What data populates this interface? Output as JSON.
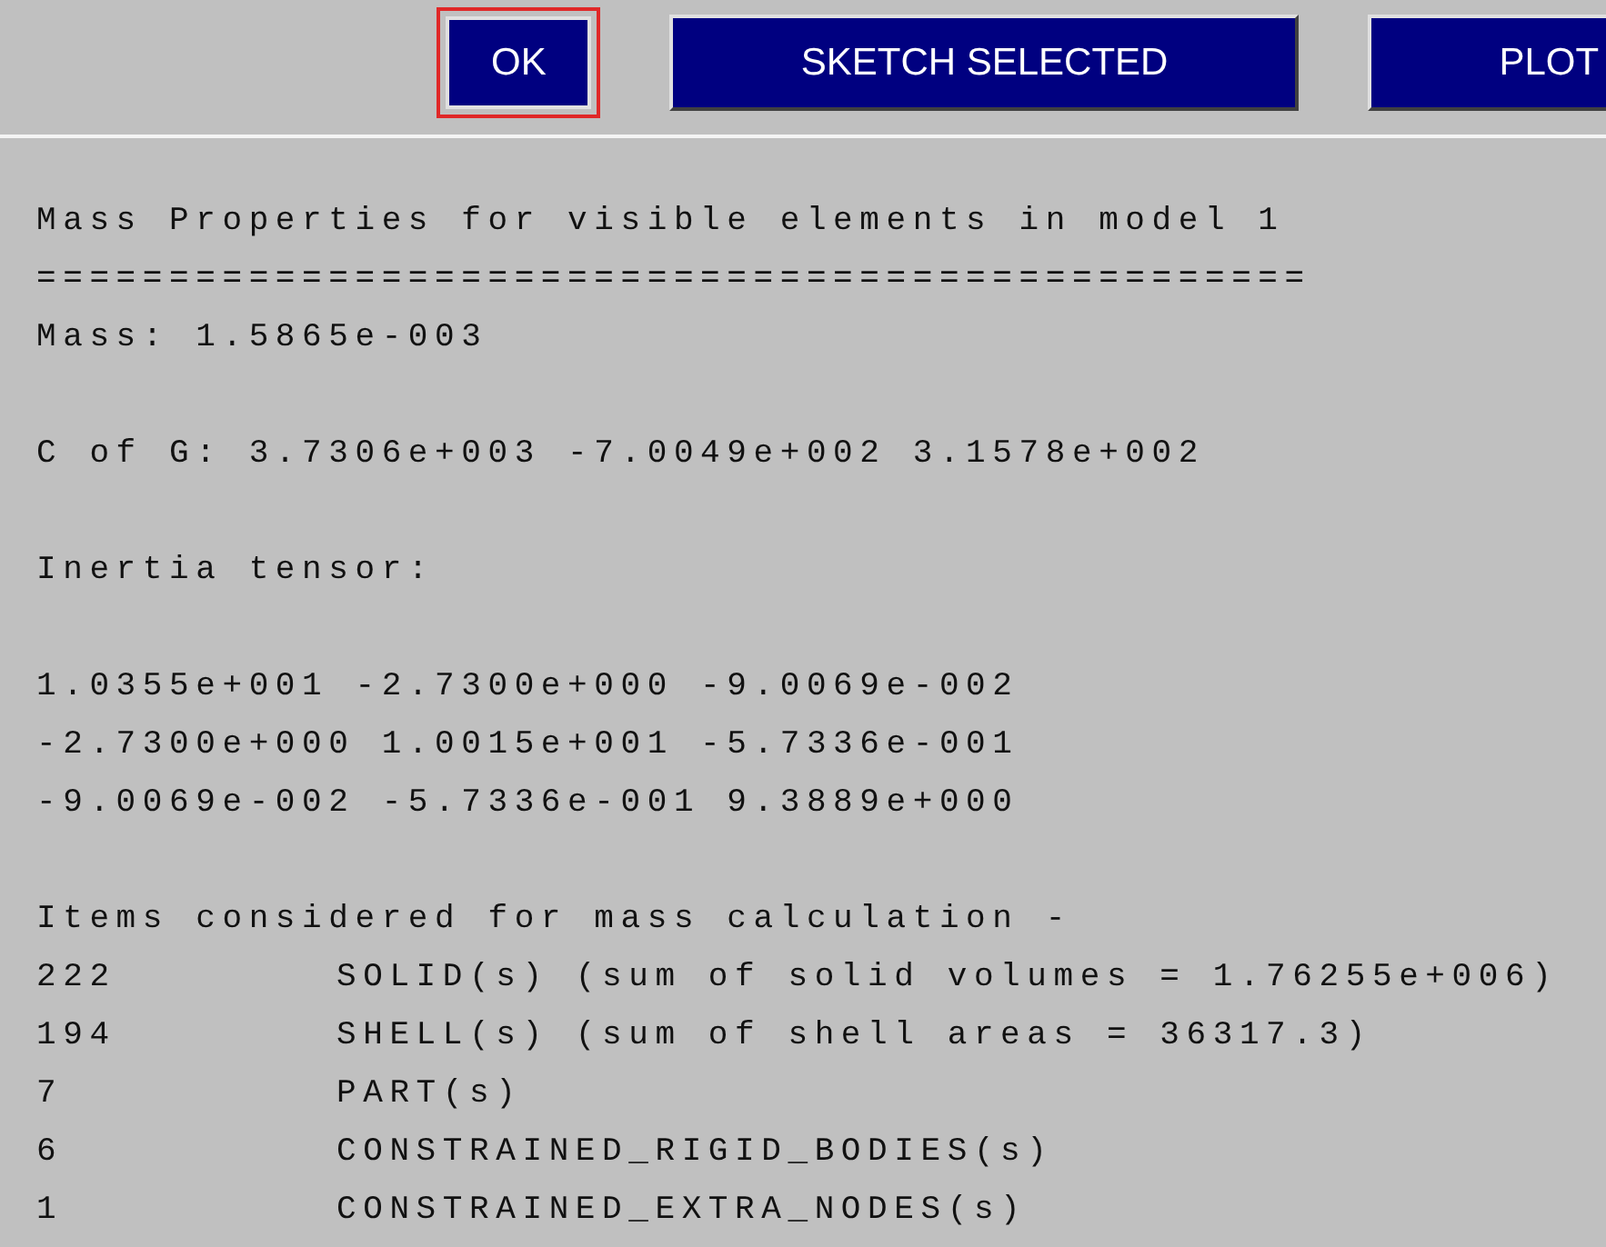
{
  "toolbar": {
    "buttons": [
      {
        "label": "OK",
        "highlighted": true
      },
      {
        "label": "SKETCH SELECTED",
        "highlighted": false
      },
      {
        "label": "PLOT",
        "highlighted": false
      }
    ]
  },
  "report": {
    "title": "Mass Properties for visible elements in model 1",
    "separator": "================================================",
    "mass": "Mass: 1.5865e-003",
    "centre_of_gravity": "C of G: 3.7306e+003 -7.0049e+002 3.1578e+002",
    "inertia_heading": "Inertia tensor:",
    "inertia_rows": [
      "1.0355e+001 -2.7300e+000 -9.0069e-002",
      "-2.7300e+000 1.0015e+001 -5.7336e-001",
      "-9.0069e-002 -5.7336e-001 9.3889e+000"
    ],
    "items_heading": "Items considered for mass calculation -",
    "items": [
      {
        "count": "222",
        "description": "SOLID(s) (sum of solid volumes = 1.76255e+006)"
      },
      {
        "count": "194",
        "description": "SHELL(s) (sum of shell areas = 36317.3)"
      },
      {
        "count": "7",
        "description": "PART(s)"
      },
      {
        "count": "6",
        "description": "CONSTRAINED_RIGID_BODIES(s)"
      },
      {
        "count": "1",
        "description": "CONSTRAINED_EXTRA_NODES(s)"
      }
    ]
  }
}
